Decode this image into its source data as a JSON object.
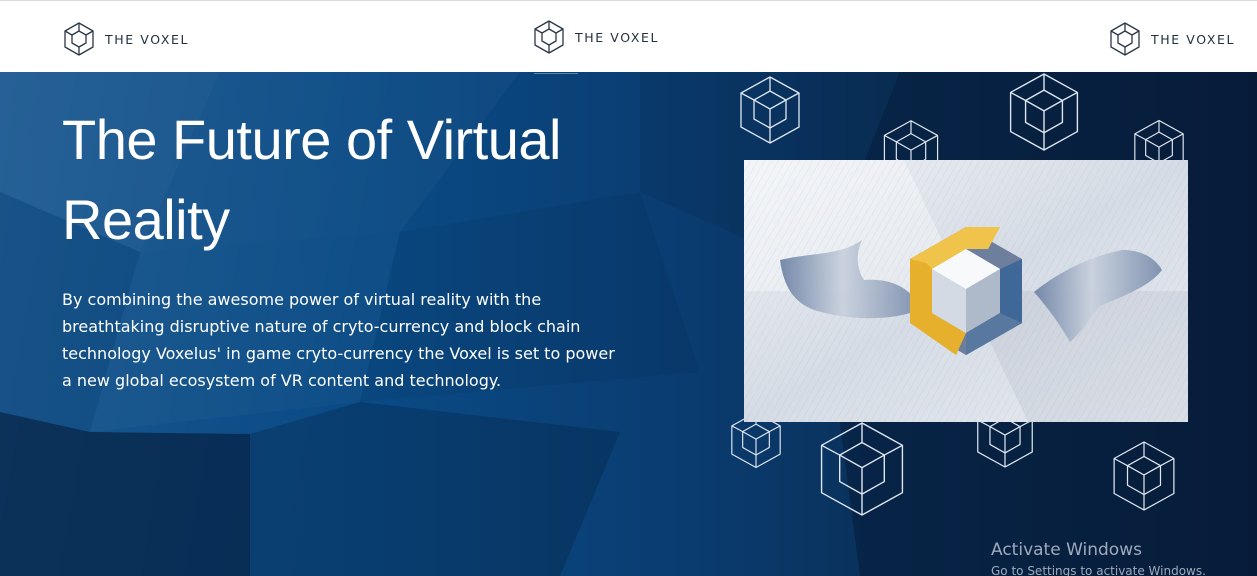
{
  "header": {
    "brand_left": "THE VOXEL",
    "brand_center": "THE VOXEL",
    "brand_right": "THE VOXEL"
  },
  "hero": {
    "title": "The Future of Virtual Reality",
    "body": "By combining the awesome power of virtual reality with the breathtaking disruptive nature of cryto-currency and block chain technology Voxelus' in game cryto-currency the Voxel is set to power a new global ecosystem of VR content and technology."
  },
  "watermark": {
    "title": "Activate Windows",
    "subtitle": "Go to Settings to activate Windows."
  },
  "colors": {
    "accent_gold": "#e6b02c",
    "logo_blue": "#3f6797",
    "hero_blue": "#0a4a85"
  },
  "icons": [
    "voxel-logo-icon",
    "wireframe-cube-icon"
  ]
}
